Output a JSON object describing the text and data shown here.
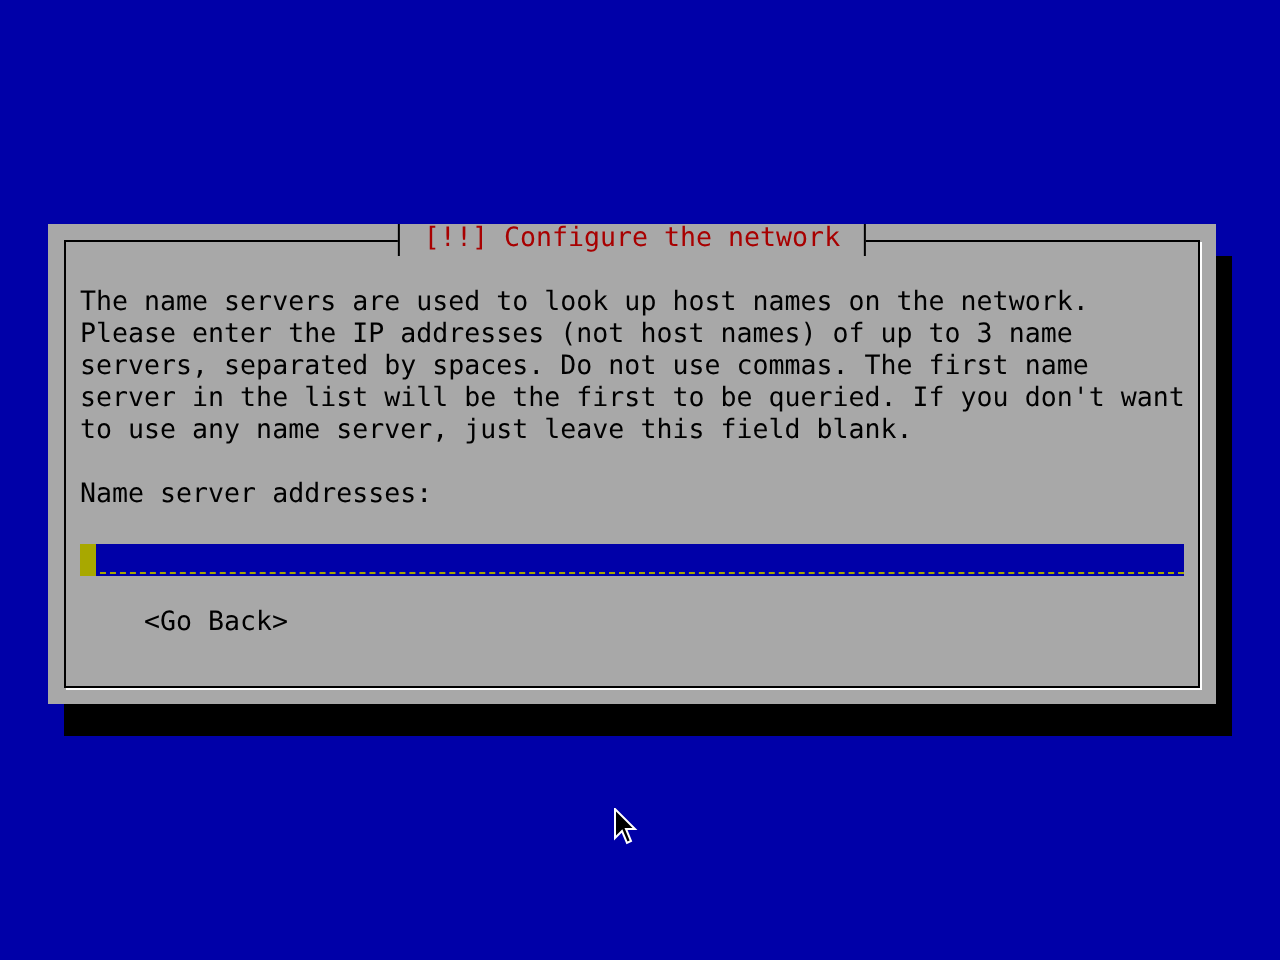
{
  "dialog": {
    "title": "[!!] Configure the network",
    "description": "The name servers are used to look up host names on the network. Please enter the IP addresses (not host names) of up to 3 name servers, separated by spaces. Do not use commas. The first name server in the list will be the first to be queried. If you don't want to use any name server, just leave this field blank.",
    "field": {
      "label": "Name server addresses:",
      "focused": true
    },
    "buttons": [
      {
        "label": "<Go Back>",
        "selected": false
      }
    ]
  }
}
